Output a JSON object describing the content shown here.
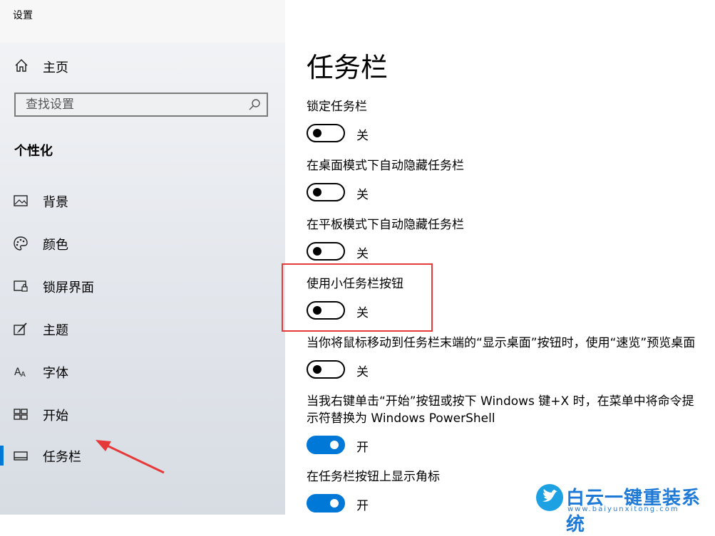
{
  "window": {
    "title": "设置"
  },
  "sidebar": {
    "home_label": "主页",
    "search_placeholder": "查找设置",
    "section_title": "个性化",
    "items": [
      {
        "label": "背景",
        "icon": "picture-icon"
      },
      {
        "label": "颜色",
        "icon": "palette-icon"
      },
      {
        "label": "锁屏界面",
        "icon": "lock-screen-icon"
      },
      {
        "label": "主题",
        "icon": "brush-icon"
      },
      {
        "label": "字体",
        "icon": "font-icon"
      },
      {
        "label": "开始",
        "icon": "start-icon"
      },
      {
        "label": "任务栏",
        "icon": "taskbar-icon",
        "selected": true
      }
    ]
  },
  "main": {
    "title": "任务栏",
    "settings": [
      {
        "label": "锁定任务栏",
        "state": "关",
        "on": false
      },
      {
        "label": "在桌面模式下自动隐藏任务栏",
        "state": "关",
        "on": false
      },
      {
        "label": "在平板模式下自动隐藏任务栏",
        "state": "关",
        "on": false
      },
      {
        "label": "使用小任务栏按钮",
        "state": "关",
        "on": false
      },
      {
        "label": "当你将鼠标移动到任务栏末端的“显示桌面”按钮时，使用“速览”预览桌面",
        "state": "关",
        "on": false
      },
      {
        "label": "当我右键单击“开始”按钮或按下 Windows 键+X 时，在菜单中将命令提示符替换为 Windows PowerShell",
        "state": "开",
        "on": true
      },
      {
        "label": "在任务栏按钮上显示角标",
        "state": "开",
        "on": true
      }
    ]
  },
  "watermark": {
    "brand": "白云一键重装系统",
    "url": "www.baiyunxitong.com"
  },
  "colors": {
    "accent": "#0078d7",
    "annotation_red": "#e63a3a",
    "watermark_blue": "#1e7ad6"
  }
}
